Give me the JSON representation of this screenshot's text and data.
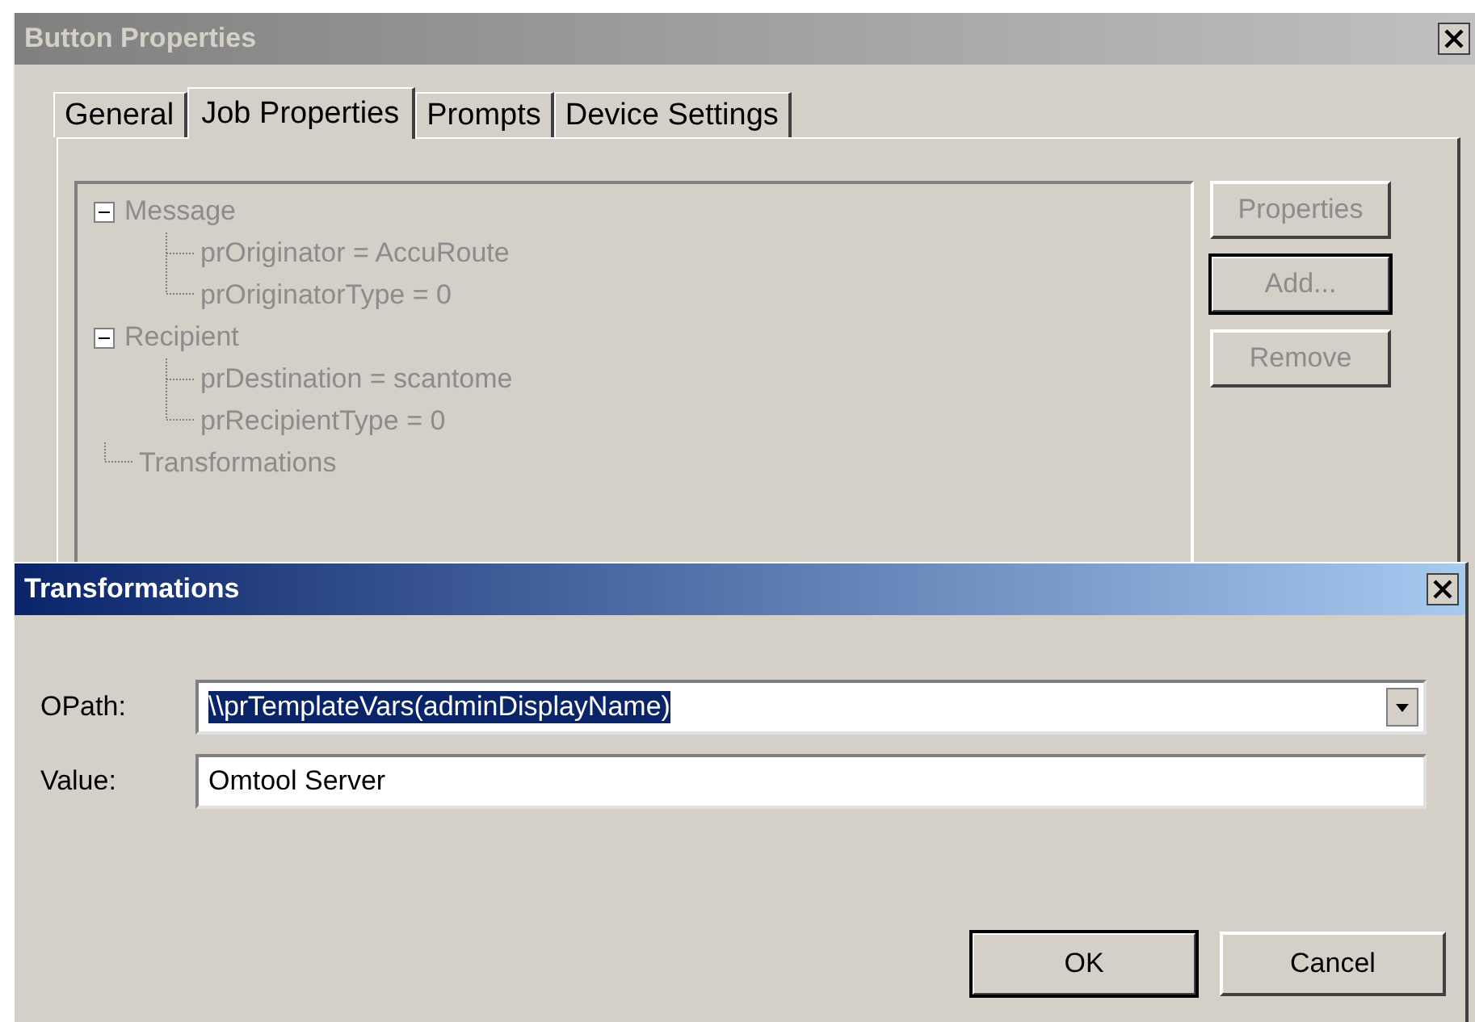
{
  "window": {
    "title": "Button Properties",
    "active": false
  },
  "tabs": [
    {
      "label": "General",
      "selected": false
    },
    {
      "label": "Job Properties",
      "selected": true
    },
    {
      "label": "Prompts",
      "selected": false
    },
    {
      "label": "Device Settings",
      "selected": false
    }
  ],
  "tree": {
    "disabled": true,
    "items": [
      {
        "label": "Message",
        "expanded": true,
        "children": [
          {
            "label": "prOriginator = AccuRoute"
          },
          {
            "label": "prOriginatorType = 0"
          }
        ]
      },
      {
        "label": "Recipient",
        "expanded": true,
        "children": [
          {
            "label": "prDestination = scantome"
          },
          {
            "label": "prRecipientType = 0"
          }
        ]
      },
      {
        "label": "Transformations"
      }
    ]
  },
  "side_buttons": [
    {
      "label": "Properties",
      "disabled": true,
      "default": false
    },
    {
      "label": "Add...",
      "disabled": true,
      "default": true
    },
    {
      "label": "Remove",
      "disabled": true,
      "default": false
    }
  ],
  "dialog": {
    "title": "Transformations",
    "active": true,
    "fields": [
      {
        "kind": "combo",
        "label": "OPath:",
        "value": "\\\\prTemplateVars(adminDisplayName)",
        "selected": true
      },
      {
        "kind": "text",
        "label": "Value:",
        "value": "Omtool Server",
        "selected": false
      }
    ],
    "buttons": [
      {
        "label": "OK",
        "default": true
      },
      {
        "label": "Cancel",
        "default": false
      }
    ]
  }
}
